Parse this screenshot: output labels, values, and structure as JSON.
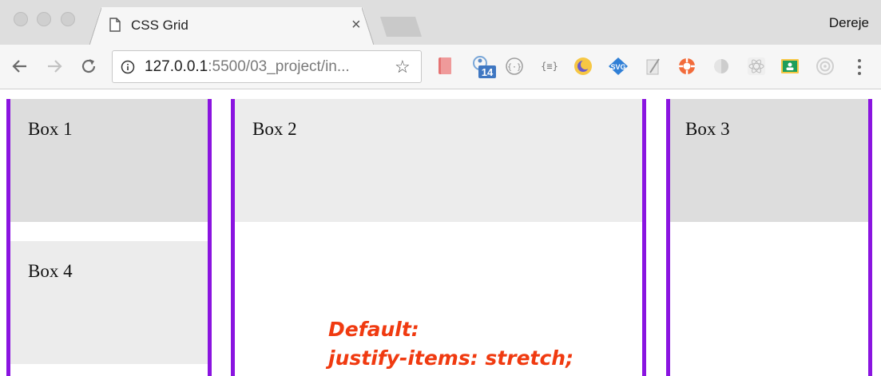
{
  "browser": {
    "tab_title": "CSS Grid",
    "tab_close": "×",
    "profile_name": "Dereje",
    "url_host": "127.0.0.1",
    "url_rest": ":5500/03_project/in...",
    "extensions": [
      "bookmark-ext-icon",
      "calendar-ext-icon",
      "code-ext-icon",
      "json-ext-icon",
      "moon-ext-icon",
      "svg-ext-icon",
      "pen-ext-icon",
      "lifebuoy-ext-icon",
      "half-circle-ext-icon",
      "react-ext-icon",
      "classroom-ext-icon",
      "target-ext-icon"
    ],
    "calendar_badge": "14",
    "json_ext_label": "{≡}",
    "svg_ext_label": "SVG"
  },
  "grid": {
    "boxes": [
      {
        "label": "Box 1",
        "bg": "#dddddd"
      },
      {
        "label": "Box 2",
        "bg": "#ececec"
      },
      {
        "label": "Box 3",
        "bg": "#dddddd"
      },
      {
        "label": "Box 4",
        "bg": "#ececec"
      }
    ],
    "column_line_color": "#8a14e0"
  },
  "annotation": {
    "line1": "Default:",
    "line2": "justify-items: stretch;",
    "color": "#f03a10"
  }
}
